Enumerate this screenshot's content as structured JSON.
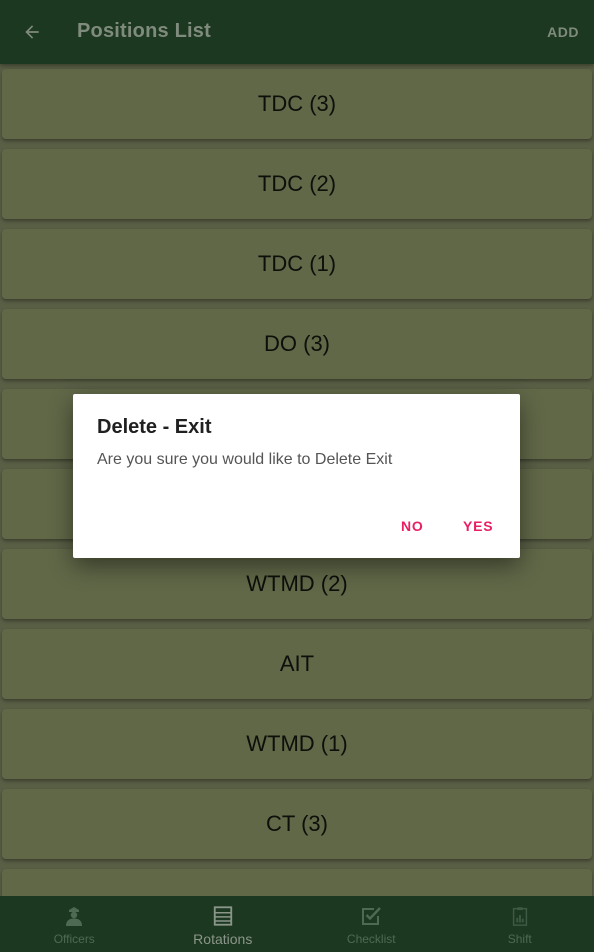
{
  "appbar": {
    "title": "Positions List",
    "add_label": "ADD"
  },
  "positions": [
    "TDC (3)",
    "TDC (2)",
    "TDC (1)",
    "DO (3)",
    "",
    "",
    "WTMD (2)",
    "AIT",
    "WTMD (1)",
    "CT (3)",
    ""
  ],
  "dialog": {
    "title": "Delete - Exit",
    "message": "Are you sure you would like to Delete Exit",
    "no_label": "NO",
    "yes_label": "YES"
  },
  "bottom_nav": [
    {
      "label": "Officers",
      "icon": "officer-icon",
      "active": false
    },
    {
      "label": "Rotations",
      "icon": "list-icon",
      "active": true
    },
    {
      "label": "Checklist",
      "icon": "checkbox-icon",
      "active": false
    },
    {
      "label": "Shift",
      "icon": "clipboard-icon",
      "active": false
    }
  ],
  "colors": {
    "appbar": "#1d3820",
    "background": "#595f45",
    "row": "#616848",
    "accent": "#e91e63"
  }
}
